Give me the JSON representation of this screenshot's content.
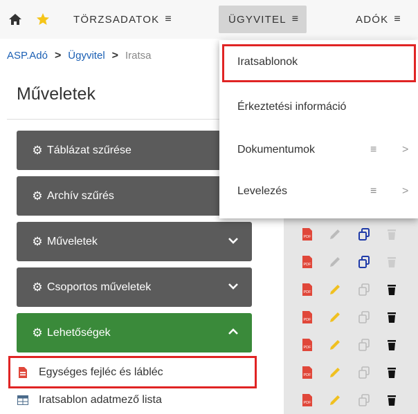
{
  "nav": {
    "torzsadatok": "TÖRZSADATOK",
    "ugyvitel": "ÜGYVITEL",
    "adok": "ADÓK",
    "menu_glyph": "≡"
  },
  "breadcrumb": {
    "root": "ASP.Adó",
    "second": "Ügyvitel",
    "current": "Iratsa",
    "separator": ">"
  },
  "page_title": "Műveletek",
  "panels": [
    {
      "label": "Táblázat szűrése",
      "icon": "gear-icon",
      "chevron": false
    },
    {
      "label": "Archív szűrés",
      "icon": "gear-icon",
      "chevron": false
    },
    {
      "label": "Műveletek",
      "icon": "gear-icon",
      "chevron": "down"
    },
    {
      "label": "Csoportos műveletek",
      "icon": "gears-icon",
      "chevron": "down"
    },
    {
      "label": "Lehetőségek",
      "icon": "gear-icon",
      "chevron": "up"
    }
  ],
  "options_list": [
    {
      "label": "Egységes fejléc és lábléc",
      "icon": "pdf-file-icon"
    },
    {
      "label": "Iratsablon adatmező lista",
      "icon": "table-icon"
    }
  ],
  "dropdown": {
    "items": [
      {
        "label": "Iratsablonok",
        "submenu": false
      },
      {
        "label": "Érkeztetési információ",
        "submenu": false
      },
      {
        "label": "Dokumentumok",
        "submenu": true
      },
      {
        "label": "Levelezés",
        "submenu": true
      }
    ],
    "submenu_glyph": "≡",
    "arrow_glyph": ">"
  },
  "row_actions": [
    {
      "edit": "disabled",
      "copy": "enabled",
      "delete": "disabled"
    },
    {
      "edit": "disabled",
      "copy": "enabled",
      "delete": "disabled"
    },
    {
      "edit": "enabled",
      "copy": "disabled",
      "delete": "enabled"
    },
    {
      "edit": "enabled",
      "copy": "disabled",
      "delete": "enabled"
    },
    {
      "edit": "enabled",
      "copy": "disabled",
      "delete": "enabled"
    },
    {
      "edit": "enabled",
      "copy": "disabled",
      "delete": "enabled"
    },
    {
      "edit": "enabled",
      "copy": "disabled",
      "delete": "enabled"
    }
  ],
  "colors": {
    "panel_gray": "#5b5b5b",
    "panel_green": "#3a8a3a",
    "highlight_red": "#e02424",
    "pdf_red": "#e0473a",
    "pencil_yellow": "#f0c020",
    "copy_blue": "#1f3aa8",
    "link_blue": "#1a5fb4"
  }
}
